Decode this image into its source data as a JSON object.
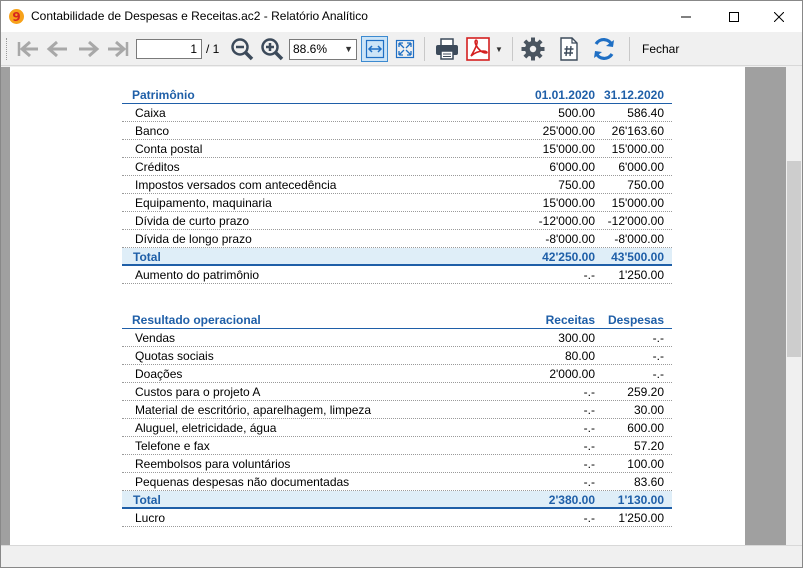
{
  "window": {
    "title": "Contabilidade de Despesas e Receitas.ac2 - Relatório Analítico",
    "minimize_icon": "minimize-icon",
    "maximize_icon": "maximize-icon",
    "close_icon": "close-icon"
  },
  "toolbar": {
    "page_current": "1",
    "page_total": "/ 1",
    "zoom": "88.6%",
    "close_label": "Fechar",
    "colors": {
      "accent": "#1f6fc4",
      "pdf": "#d42020"
    }
  },
  "report": {
    "balance": {
      "header": {
        "label": "Patrimônio",
        "col1": "01.01.2020",
        "col2": "31.12.2020"
      },
      "rows": [
        {
          "label": "Caixa",
          "col1": "500.00",
          "col2": "586.40"
        },
        {
          "label": "Banco",
          "col1": "25'000.00",
          "col2": "26'163.60"
        },
        {
          "label": "Conta postal",
          "col1": "15'000.00",
          "col2": "15'000.00"
        },
        {
          "label": "Créditos",
          "col1": "6'000.00",
          "col2": "6'000.00"
        },
        {
          "label": "Impostos versados com antecedência",
          "col1": "750.00",
          "col2": "750.00"
        },
        {
          "label": "Equipamento, maquinaria",
          "col1": "15'000.00",
          "col2": "15'000.00"
        },
        {
          "label": "Dívida de curto prazo",
          "col1": "-12'000.00",
          "col2": "-12'000.00"
        },
        {
          "label": "Dívida de longo prazo",
          "col1": "-8'000.00",
          "col2": "-8'000.00"
        }
      ],
      "total": {
        "label": "Total",
        "col1": "42'250.00",
        "col2": "43'500.00"
      },
      "after": {
        "label": "Aumento do patrimônio",
        "col1": "-.-",
        "col2": "1'250.00"
      }
    },
    "operational": {
      "header": {
        "label": "Resultado operacional",
        "col1": "Receitas",
        "col2": "Despesas"
      },
      "rows": [
        {
          "label": "Vendas",
          "col1": "300.00",
          "col2": "-.-"
        },
        {
          "label": "Quotas sociais",
          "col1": "80.00",
          "col2": "-.-"
        },
        {
          "label": "Doações",
          "col1": "2'000.00",
          "col2": "-.-"
        },
        {
          "label": "Custos para o projeto A",
          "col1": "-.-",
          "col2": "259.20"
        },
        {
          "label": "Material de escritório, aparelhagem, limpeza",
          "col1": "-.-",
          "col2": "30.00"
        },
        {
          "label": "Aluguel, eletricidade, água",
          "col1": "-.-",
          "col2": "600.00"
        },
        {
          "label": "Telefone e fax",
          "col1": "-.-",
          "col2": "57.20"
        },
        {
          "label": "Reembolsos para voluntários",
          "col1": "-.-",
          "col2": "100.00"
        },
        {
          "label": "Pequenas despesas não documentadas",
          "col1": "-.-",
          "col2": "83.60"
        }
      ],
      "total": {
        "label": "Total",
        "col1": "2'380.00",
        "col2": "1'130.00"
      },
      "after": {
        "label": "Lucro",
        "col1": "-.-",
        "col2": "1'250.00"
      }
    }
  }
}
